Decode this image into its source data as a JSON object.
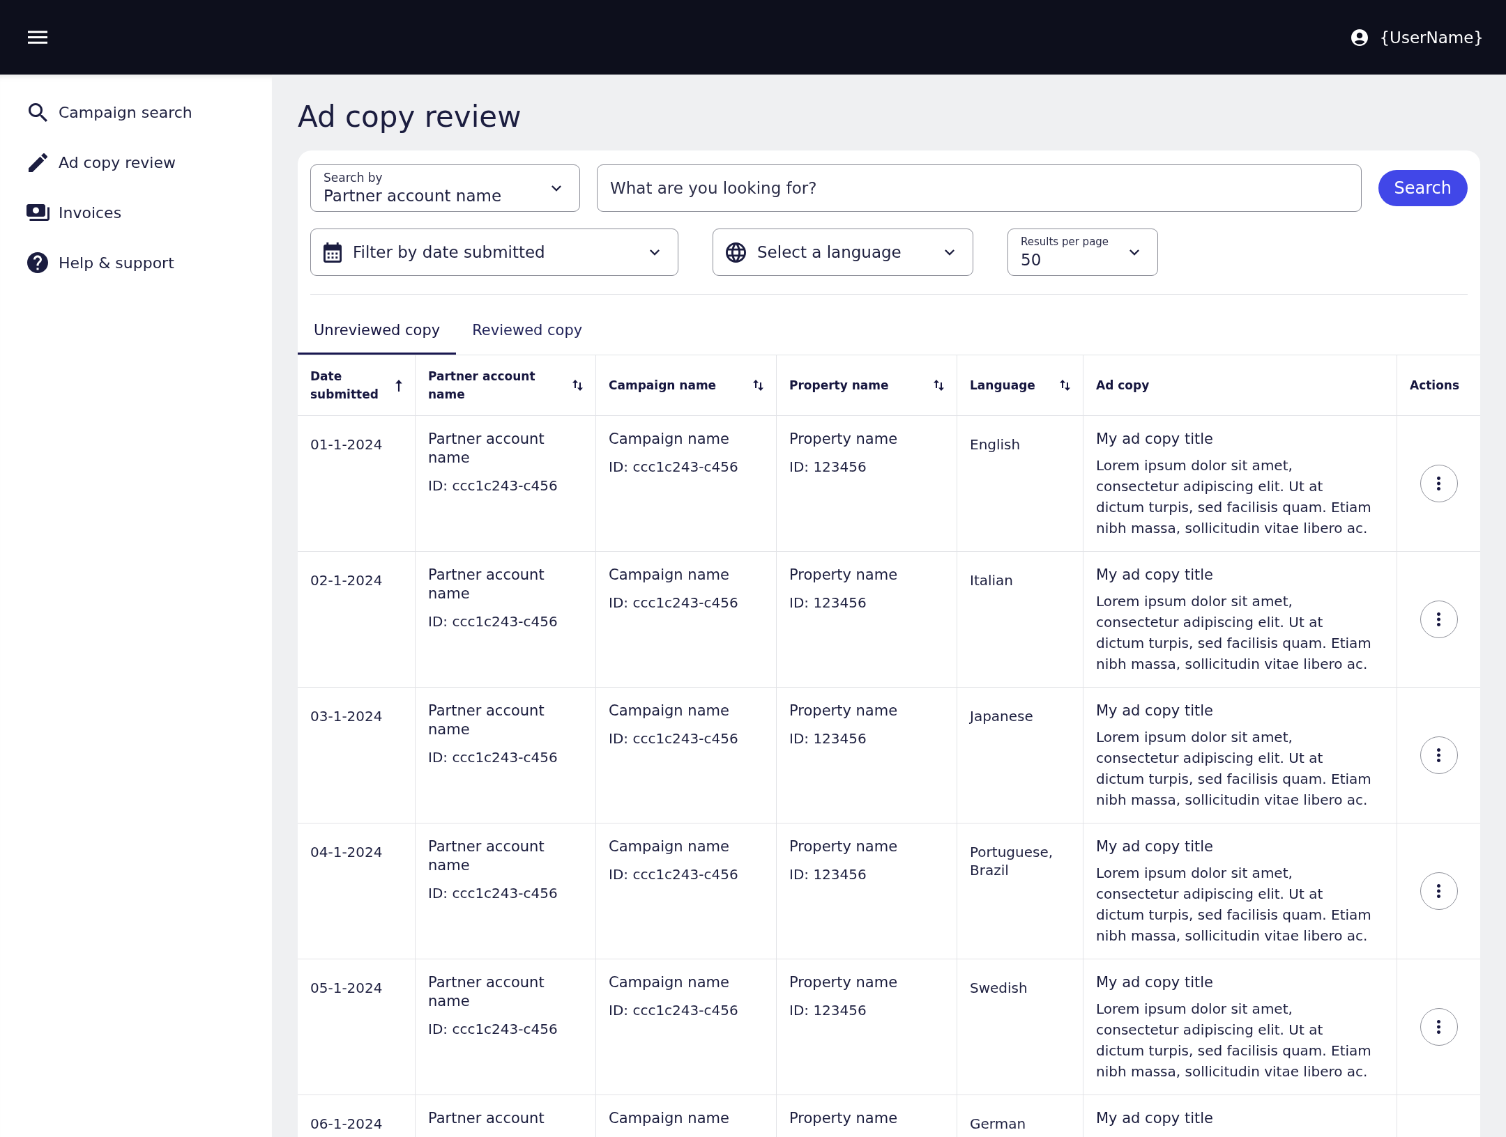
{
  "top_bar": {
    "user_name": "{UserName}"
  },
  "sidebar": {
    "items": [
      "Campaign search",
      "Ad copy review",
      "Invoices",
      "Help & support"
    ]
  },
  "page_title": "Ad copy review",
  "filters": {
    "search_by": {
      "label": "Search by",
      "value": "Partner account name"
    },
    "search_field": {
      "placeholder": "What are you looking for?"
    },
    "search_button": "Search",
    "date_filter": {
      "label": "Filter by date submitted"
    },
    "language_filter": {
      "label": "Select a language"
    },
    "results_per_page": {
      "label": "Results per page",
      "value": "50"
    }
  },
  "tabs": [
    {
      "label": "Unreviewed copy",
      "selected": true
    },
    {
      "label": "Reviewed copy",
      "selected": false
    }
  ],
  "table": {
    "columns": [
      {
        "label": "Date submitted",
        "sortable": true,
        "sorted": true
      },
      {
        "label": "Partner account name",
        "sortable": true,
        "sorted": false
      },
      {
        "label": "Campaign name",
        "sortable": true,
        "sorted": false
      },
      {
        "label": "Property name",
        "sortable": true,
        "sorted": false
      },
      {
        "label": "Language",
        "sortable": true,
        "sorted": false
      },
      {
        "label": "Ad copy",
        "sortable": false
      },
      {
        "label": "Actions",
        "sortable": false
      }
    ],
    "rows": [
      {
        "date": "01-1-2024",
        "partner_name": "Partner account name",
        "partner_id": "ID: ccc1c243-c456",
        "campaign_name": "Campaign name",
        "campaign_id": "ID: ccc1c243-c456",
        "property_name": "Property name",
        "property_id": "ID: 123456",
        "language": "English",
        "ad_title": "My ad copy title",
        "ad_body": "Lorem ipsum dolor sit amet, consectetur adipiscing elit. Ut at dictum turpis, sed facilisis quam. Etiam nibh massa, sollicitudin vitae libero ac."
      },
      {
        "date": "02-1-2024",
        "partner_name": "Partner account name",
        "partner_id": "ID: ccc1c243-c456",
        "campaign_name": "Campaign name",
        "campaign_id": "ID: ccc1c243-c456",
        "property_name": "Property name",
        "property_id": "ID: 123456",
        "language": "Italian",
        "ad_title": "My ad copy title",
        "ad_body": "Lorem ipsum dolor sit amet, consectetur adipiscing elit. Ut at dictum turpis, sed facilisis quam. Etiam nibh massa, sollicitudin vitae libero ac."
      },
      {
        "date": "03-1-2024",
        "partner_name": "Partner account name",
        "partner_id": "ID: ccc1c243-c456",
        "campaign_name": "Campaign name",
        "campaign_id": "ID: ccc1c243-c456",
        "property_name": "Property name",
        "property_id": "ID: 123456",
        "language": "Japanese",
        "ad_title": "My ad copy title",
        "ad_body": "Lorem ipsum dolor sit amet, consectetur adipiscing elit. Ut at dictum turpis, sed facilisis quam. Etiam nibh massa, sollicitudin vitae libero ac."
      },
      {
        "date": "04-1-2024",
        "partner_name": "Partner account name",
        "partner_id": "ID: ccc1c243-c456",
        "campaign_name": "Campaign name",
        "campaign_id": "ID: ccc1c243-c456",
        "property_name": "Property name",
        "property_id": "ID: 123456",
        "language": "Portuguese, Brazil",
        "ad_title": "My ad copy title",
        "ad_body": "Lorem ipsum dolor sit amet, consectetur adipiscing elit. Ut at dictum turpis, sed facilisis quam. Etiam nibh massa, sollicitudin vitae libero ac."
      },
      {
        "date": "05-1-2024",
        "partner_name": "Partner account name",
        "partner_id": "ID: ccc1c243-c456",
        "campaign_name": "Campaign name",
        "campaign_id": "ID: ccc1c243-c456",
        "property_name": "Property name",
        "property_id": "ID: 123456",
        "language": "Swedish",
        "ad_title": "My ad copy title",
        "ad_body": "Lorem ipsum dolor sit amet, consectetur adipiscing elit. Ut at dictum turpis, sed facilisis quam. Etiam nibh massa, sollicitudin vitae libero ac."
      },
      {
        "date": "06-1-2024",
        "partner_name": "Partner account",
        "campaign_name": "Campaign name",
        "property_name": "Property name",
        "language": "German",
        "ad_title": "My ad copy title"
      }
    ]
  }
}
